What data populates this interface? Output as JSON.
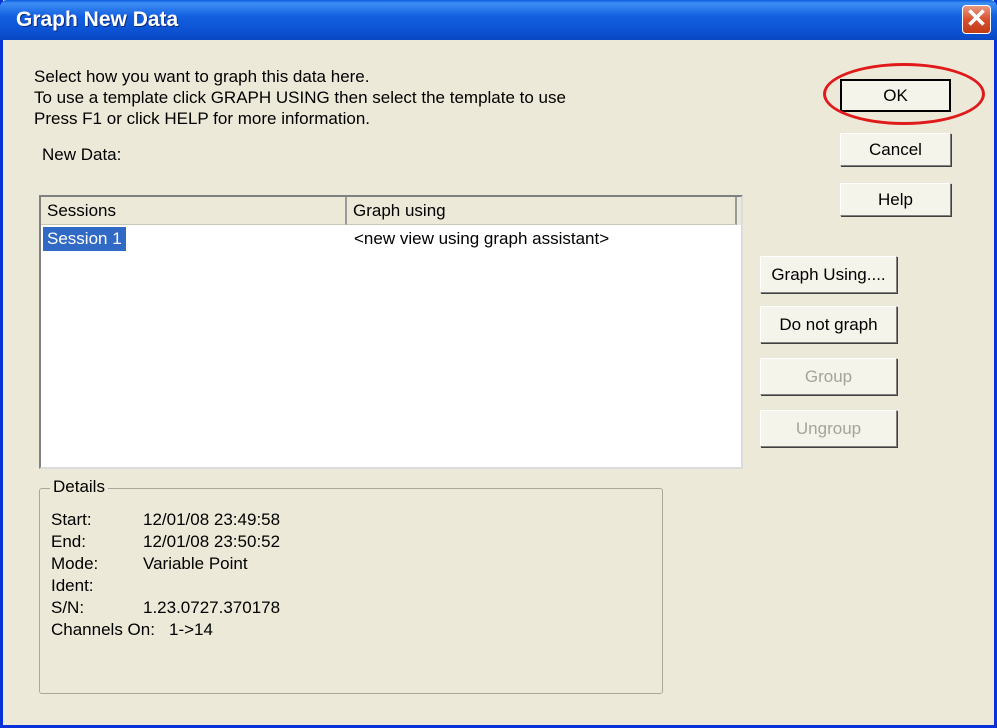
{
  "window": {
    "title": "Graph New Data",
    "close_glyph": "✕"
  },
  "instructions": [
    "Select how you want to graph this data here.",
    "To use a template click GRAPH USING then select the template to use",
    "Press F1 or click HELP for more information."
  ],
  "new_data_label": "New Data:",
  "list": {
    "columns": [
      "Sessions",
      "Graph using"
    ],
    "rows": [
      {
        "session": "Session 1",
        "graph_using": "<new view using graph assistant>",
        "selected": true
      }
    ]
  },
  "buttons": {
    "ok": "OK",
    "cancel": "Cancel",
    "help": "Help",
    "graph_using": "Graph Using....",
    "do_not_graph": "Do not graph",
    "group": "Group",
    "ungroup": "Ungroup"
  },
  "details": {
    "legend": "Details",
    "start_label": "Start:",
    "start_value": "12/01/08 23:49:58",
    "end_label": "End:",
    "end_value": "12/01/08 23:50:52",
    "mode_label": "Mode:",
    "mode_value": "Variable Point",
    "ident_label": "Ident:",
    "ident_value": "",
    "sn_label": "S/N:",
    "sn_value": "1.23.0727.370178",
    "channels_label": "Channels On:",
    "channels_value": "1->14"
  },
  "colors": {
    "titlebar": "#0a4fd0",
    "dialog_bg": "#ece9d8",
    "selection": "#316ac5",
    "highlight_circle": "#e01a1a"
  }
}
